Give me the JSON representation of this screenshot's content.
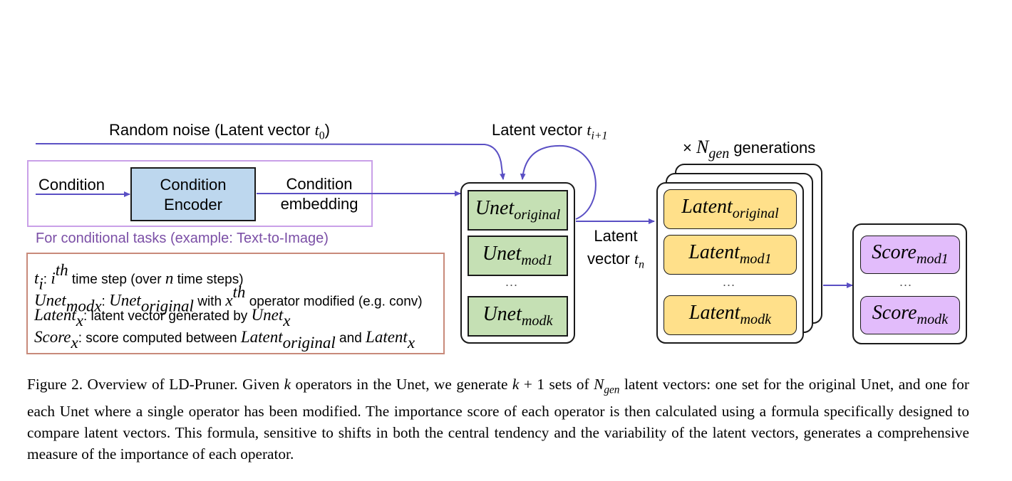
{
  "colors": {
    "arrow": "#5a4fc4",
    "condition_frame": "#c9a0e8",
    "condition_note": "#7b4fa6",
    "legend_frame": "#c88a7a",
    "encoder_fill": "#bdd7ee",
    "unet_fill": "#c5e0b4",
    "latent_fill": "#ffe08a",
    "score_fill": "#e2bcfb"
  },
  "top_labels": {
    "random_noise": "Random noise (Latent vector ",
    "random_noise_var": "t",
    "random_noise_sub": "0",
    "random_noise_close": ")",
    "loop_label": "Latent vector ",
    "loop_var": "t",
    "loop_sub": "i+1",
    "gen_prefix": "× ",
    "gen_var": "N",
    "gen_sub": "gen",
    "gen_suffix": " generations"
  },
  "condition": {
    "input_label": "Condition",
    "encoder_line1": "Condition",
    "encoder_line2": "Encoder",
    "output_line1": "Condition",
    "output_line2": "embedding",
    "note": "For conditional tasks (example: Text-to-Image)"
  },
  "unet_stack": {
    "items": [
      {
        "base": "Unet",
        "sub": "original"
      },
      {
        "base": "Unet",
        "sub": "mod1"
      },
      {
        "base": "Unet",
        "sub": "modk"
      }
    ],
    "ellipsis": "..."
  },
  "latent_output_label": {
    "line1": "Latent",
    "line2": "vector ",
    "var": "t",
    "sub": "n"
  },
  "latent_stack": {
    "items": [
      {
        "base": "Latent",
        "sub": "original"
      },
      {
        "base": "Latent",
        "sub": "mod1"
      },
      {
        "base": "Latent",
        "sub": "modk"
      }
    ],
    "ellipsis": "..."
  },
  "score_stack": {
    "items": [
      {
        "base": "Score",
        "sub": "mod1"
      },
      {
        "base": "Score",
        "sub": "modk"
      }
    ],
    "ellipsis": "..."
  },
  "legend": {
    "line1": {
      "var": "t",
      "sub": "i",
      "colon": ": ",
      "var2": "i",
      "sup": "th",
      "text": " time step (over ",
      "var3": "n",
      "text2": " time steps)"
    },
    "line2": {
      "var": "Unet",
      "sub": "modx",
      "colon": ": ",
      "var2": "Unet",
      "sub2": "original",
      "text": " with ",
      "var3": "x",
      "sup": "th",
      "text2": " operator modified (e.g. conv)"
    },
    "line3": {
      "var": "Latent",
      "sub": "x",
      "text": ": latent vector generated by ",
      "var2": "Unet",
      "sub2": "x"
    },
    "line4": {
      "var": "Score",
      "sub": "x",
      "text": ": score computed between ",
      "var2": "Latent",
      "sub2": "original",
      "text2": " and ",
      "var3": "Latent",
      "sub3": "x"
    }
  },
  "caption": {
    "text_1": "Figure 2. Overview of LD-Pruner. Given ",
    "k1": "k",
    "text_2": " operators in the Unet, we generate ",
    "k2": "k",
    "text_3": " + 1 sets of ",
    "n": "N",
    "n_sub": "gen",
    "text_4": " latent vectors: one set for the original Unet, and one for each Unet where a single operator has been modified. The importance score of each operator is then calculated using a formula specifically designed to compare latent vectors. This formula, sensitive to shifts in both the central tendency and the variability of the latent vectors, generates a comprehensive measure of the importance of each operator."
  }
}
